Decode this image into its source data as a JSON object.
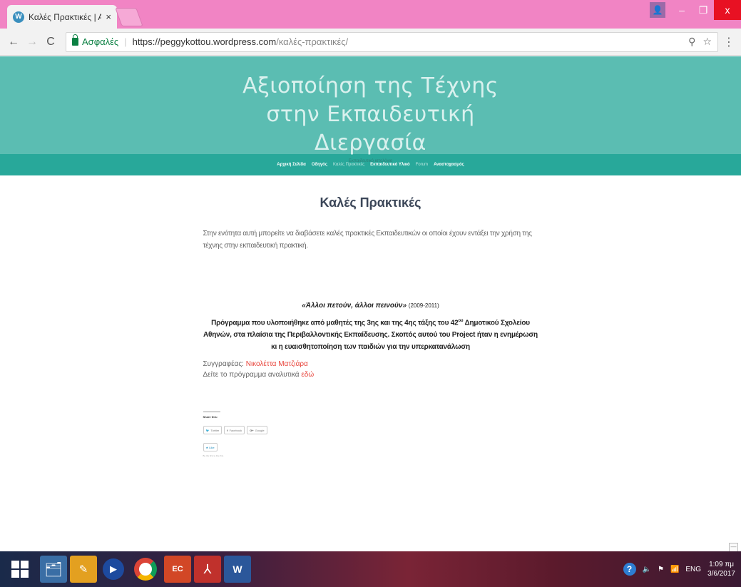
{
  "browser": {
    "tab_title": "Καλές Πρακτικές | Αξιοπ",
    "tab_close": "×",
    "favicon": "W",
    "secure_label": "Ασφαλές",
    "url_host": "https://peggykottou.wordpress.com",
    "url_path": "/καλές-πρακτικές/",
    "zoom_icon": "zoom-icon",
    "star_icon": "bookmark-star-icon"
  },
  "window": {
    "minimize": "–",
    "maximize": "❐",
    "close": "x"
  },
  "site": {
    "title": "Αξιοποίηση της Τέχνης στην Εκπαιδευτική Διεργασία",
    "tagline": "Εκπαιδευτικό ιστολόγιο",
    "header_color": "#5bbdb2",
    "nav_color": "#28a89a",
    "nav": [
      {
        "label": "Αρχική Σελίδα"
      },
      {
        "label": "Οδηγός"
      },
      {
        "label": "Καλές Πρακτικές"
      },
      {
        "label": "Εκπαιδευτικό Υλικό"
      },
      {
        "label": "Forum"
      },
      {
        "label": "Αναστοχασμός"
      }
    ]
  },
  "page": {
    "title": "Καλές Πρακτικές",
    "intro": "Στην ενότητα αυτή μπορείτε να διαβάσετε καλές πρακτικές Εκπαιδευτικών οι οποίοι έχουν εντάξει την χρήση της τέχνης στην εκπαιδευτική πρακτική.",
    "project_name": "«Άλλοι πετούν, άλλοι πεινούν»",
    "project_years": "(2009-2011)",
    "project_desc_1": "Πρόγραμμα που υλοποιήθηκε από μαθητές της 3ης και της 4ης τάξης του 42",
    "project_desc_sup": "ου",
    "project_desc_2": " Δημοτικού Σχολείου Αθηνών, στα πλαίσια της Περιβαλλοντικής Εκπαίδευσης. Σκοπός αυτού του Project ήταν η ενημέρωση κι η ευαισθητοποίηση των παιδιών για την υπερκατανάλωση",
    "author_label": "Συγγραφέας: ",
    "author_name": "Νικολέττα Ματζιάρα",
    "see_label": "Δείτε το πρόγραμμα αναλυτικά ",
    "see_link": "εδώ",
    "link_color": "#e8453c"
  },
  "share": {
    "title": "Share this:",
    "twitter": "Twitter",
    "facebook": "Facebook",
    "google": "Google",
    "like": "Like",
    "like_note": "Be the first to like this."
  },
  "taskbar": {
    "tray_lang": "ENG",
    "time": "1:09 πμ",
    "date": "3/6/2017"
  }
}
